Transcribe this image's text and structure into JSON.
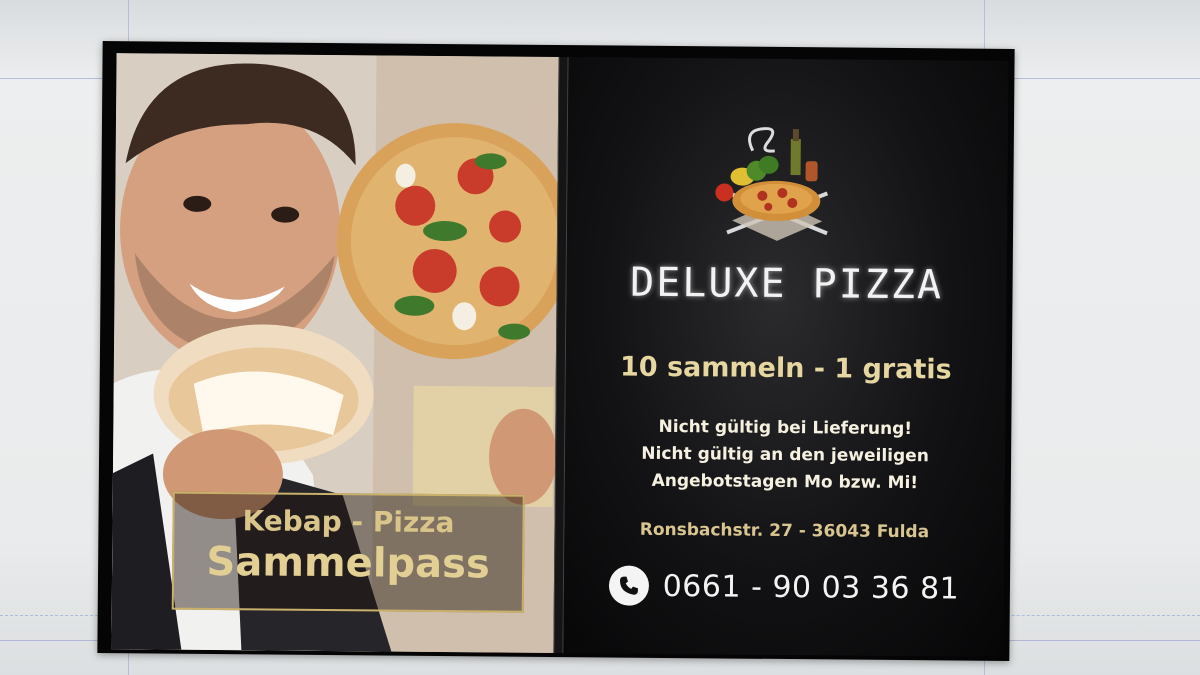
{
  "card": {
    "promo_box": {
      "line1": "Kebap - Pizza",
      "line2": "Sammelpass"
    },
    "brand_name": "DELUXE PIZZA",
    "offer": "10 sammeln - 1 gratis",
    "conditions": [
      "Nicht gültig bei Lieferung!",
      "Nicht gültig an den jeweiligen",
      "Angebotstagen Mo bzw. Mi!"
    ],
    "address": "Ronsbachstr. 27 - 36043 Fulda",
    "phone": "0661 - 90 03 36 81",
    "icons": {
      "logo": "pizza-logo-icon",
      "phone": "phone-icon"
    }
  },
  "colors": {
    "card_background": "#050506",
    "gold_text": "#d9c48a",
    "white_text": "#f2f2f2"
  }
}
